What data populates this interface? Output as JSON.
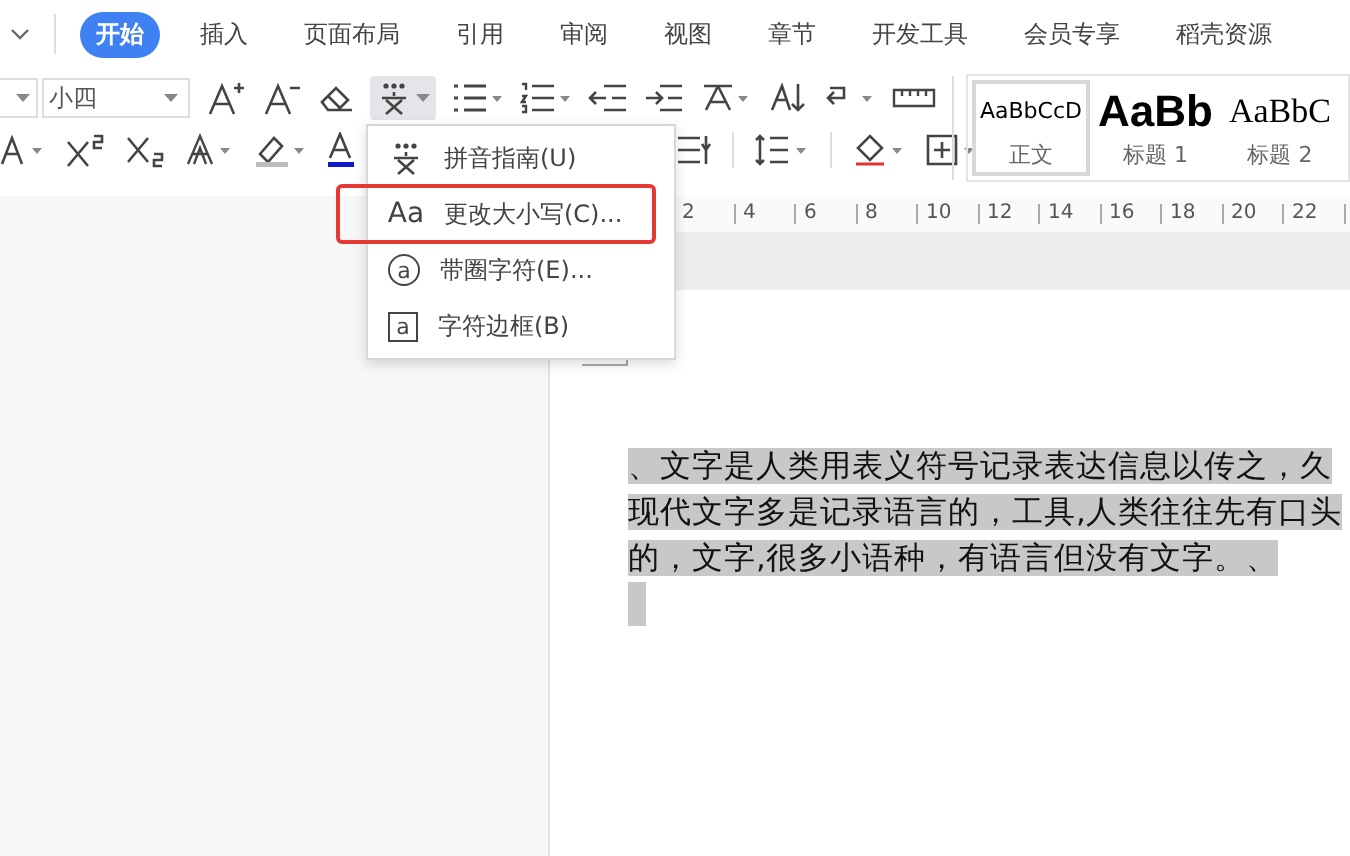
{
  "tabs": [
    {
      "label": "开始",
      "selected": true
    },
    {
      "label": "插入",
      "selected": false
    },
    {
      "label": "页面布局",
      "selected": false
    },
    {
      "label": "引用",
      "selected": false
    },
    {
      "label": "审阅",
      "selected": false
    },
    {
      "label": "视图",
      "selected": false
    },
    {
      "label": "章节",
      "selected": false
    },
    {
      "label": "开发工具",
      "selected": false
    },
    {
      "label": "会员专享",
      "selected": false
    },
    {
      "label": "稻壳资源",
      "selected": false
    }
  ],
  "toolbar": {
    "font_size": "小四"
  },
  "style_gallery": [
    {
      "kind": "body",
      "sample": "AaBbCcD",
      "name": "正文",
      "selected": true
    },
    {
      "kind": "heading1",
      "sample": "AaBb",
      "name": "标题 1",
      "selected": false
    },
    {
      "kind": "heading2",
      "sample": "AaBbC",
      "name": "标题 2",
      "selected": false
    }
  ],
  "dropdown_menu": {
    "items": [
      {
        "kind": "pinyin",
        "label": "拼音指南(U)",
        "highlighted": false
      },
      {
        "kind": "case",
        "icon": "Aa",
        "label": "更改大小写(C)...",
        "highlighted": true
      },
      {
        "kind": "enclose",
        "icon": "a",
        "label": "带圈字符(E)...",
        "highlighted": false
      },
      {
        "kind": "border",
        "icon": "a",
        "label": "字符边框(B)",
        "highlighted": false
      }
    ]
  },
  "ruler": {
    "marks": [
      "2",
      "4",
      "6",
      "8",
      "10",
      "12",
      "14",
      "16",
      "18",
      "20",
      "22"
    ]
  },
  "document": {
    "selected": true,
    "lines": [
      "、文字是人类用表义符号记录表达信息以传之，久",
      "现代文字多是记录语言的，工具,人类往往先有口头",
      "的，文字,很多小语种，有语言但没有文字。、"
    ]
  }
}
